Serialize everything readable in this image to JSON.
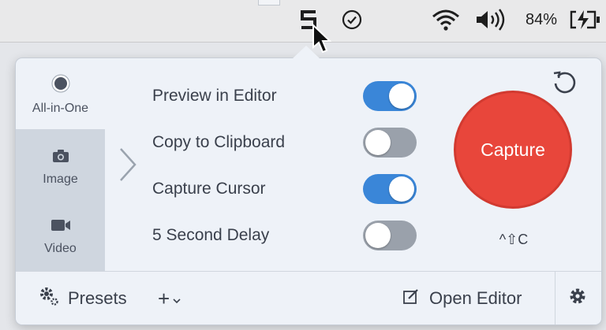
{
  "menubar": {
    "items": [
      "snagit-icon",
      "check-circle-icon",
      "wifi-icon",
      "volume-icon"
    ],
    "battery_percent": "84%",
    "battery_state": "charging"
  },
  "modes": [
    {
      "label": "All-in-One",
      "icon": "record-dot-icon",
      "selected": true
    },
    {
      "label": "Image",
      "icon": "camera-icon",
      "selected": false
    },
    {
      "label": "Video",
      "icon": "video-camera-icon",
      "selected": false
    }
  ],
  "options": [
    {
      "label": "Preview in Editor",
      "on": true
    },
    {
      "label": "Copy to Clipboard",
      "on": false
    },
    {
      "label": "Capture Cursor",
      "on": true
    },
    {
      "label": "5 Second Delay",
      "on": false
    }
  ],
  "capture": {
    "label": "Capture",
    "shortcut": "^⇧C",
    "color": "#e8463b"
  },
  "bottom": {
    "presets_label": "Presets",
    "add_label": "+",
    "open_editor_label": "Open Editor"
  },
  "colors": {
    "toggle_on": "#3a86d8",
    "toggle_off": "#9aa1ab",
    "panel": "#eef2f8"
  }
}
